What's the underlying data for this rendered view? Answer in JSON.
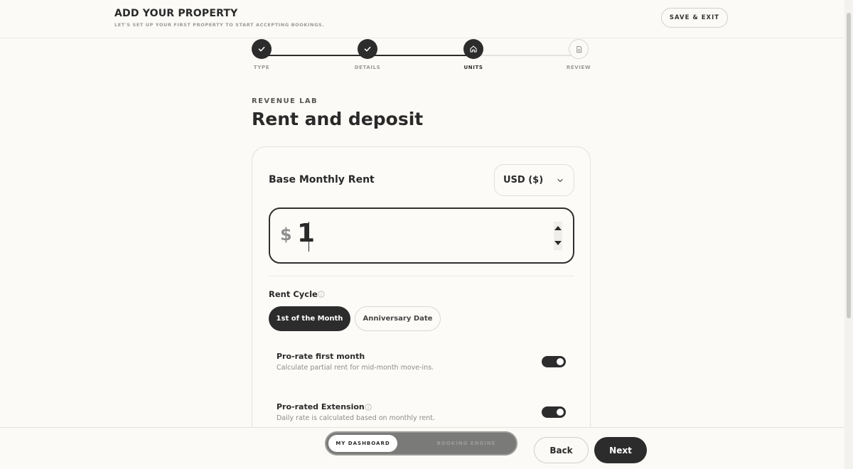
{
  "header": {
    "title": "ADD YOUR PROPERTY",
    "subtitle": "LET'S SET UP YOUR FIRST PROPERTY TO START ACCEPTING BOOKINGS.",
    "save_exit_label": "SAVE & EXIT"
  },
  "stepper": {
    "steps": [
      {
        "label": "TYPE",
        "status": "complete",
        "icon": "check-icon"
      },
      {
        "label": "DETAILS",
        "status": "complete",
        "icon": "check-icon"
      },
      {
        "label": "UNITS",
        "status": "active",
        "icon": "home-icon"
      },
      {
        "label": "REVIEW",
        "status": "pending",
        "icon": "document-icon"
      }
    ]
  },
  "section": {
    "eyebrow": "REVENUE LAB",
    "title": "Rent and deposit"
  },
  "rent": {
    "label": "Base Monthly Rent",
    "currency": "USD ($)",
    "currency_symbol": "$",
    "value": "1"
  },
  "rent_cycle": {
    "label": "Rent Cycle",
    "options": [
      {
        "label": "1st of the Month",
        "selected": true
      },
      {
        "label": "Anniversary Date",
        "selected": false
      }
    ]
  },
  "options": [
    {
      "title": "Pro-rate first month",
      "description": "Calculate partial rent for mid-month move-ins.",
      "enabled": true
    },
    {
      "title": "Pro-rated Extension",
      "description": "Daily rate is calculated based on monthly rent.",
      "enabled": true
    }
  ],
  "footer": {
    "segments": [
      "MY DASHBOARD",
      "BOOKING ENGINE"
    ],
    "back_label": "Back",
    "next_label": "Next"
  },
  "colors": {
    "background": "#fbfaf6",
    "primary_dark": "#2c2c2c",
    "muted_text": "#9a9a9a"
  }
}
